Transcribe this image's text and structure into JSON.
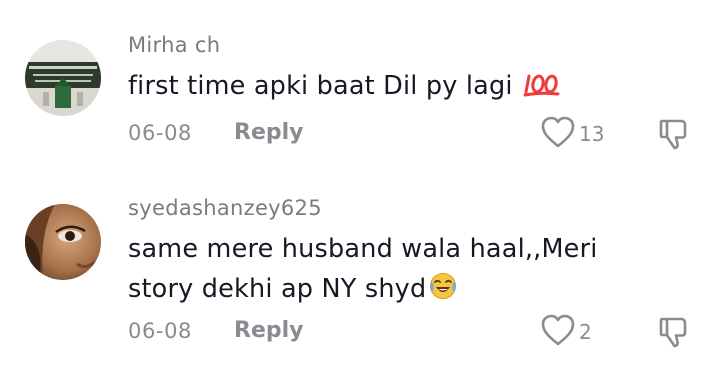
{
  "comments": [
    {
      "username": "Mirha ch",
      "text": "first time apki baat Dil py lagi",
      "emoji": "💯",
      "date": "06-08",
      "reply_label": "Reply",
      "likes": "13",
      "avatar_icon": "image-avatar"
    },
    {
      "username": "syedashanzey625",
      "text_line1": "same mere husband wala haal,,Meri",
      "text_line2": "story dekhi ap NY shyd",
      "emoji": "😂",
      "date": "06-08",
      "reply_label": "Reply",
      "likes": "2",
      "avatar_icon": "image-avatar"
    }
  ],
  "icons": {
    "like": "heart-outline-icon",
    "dislike": "thumbs-down-outline-icon"
  },
  "colors": {
    "username": "#7a7b80",
    "text": "#161823",
    "meta": "#8a8b91",
    "hundred": "#f23a3a",
    "laugh": "#f7c63f"
  }
}
